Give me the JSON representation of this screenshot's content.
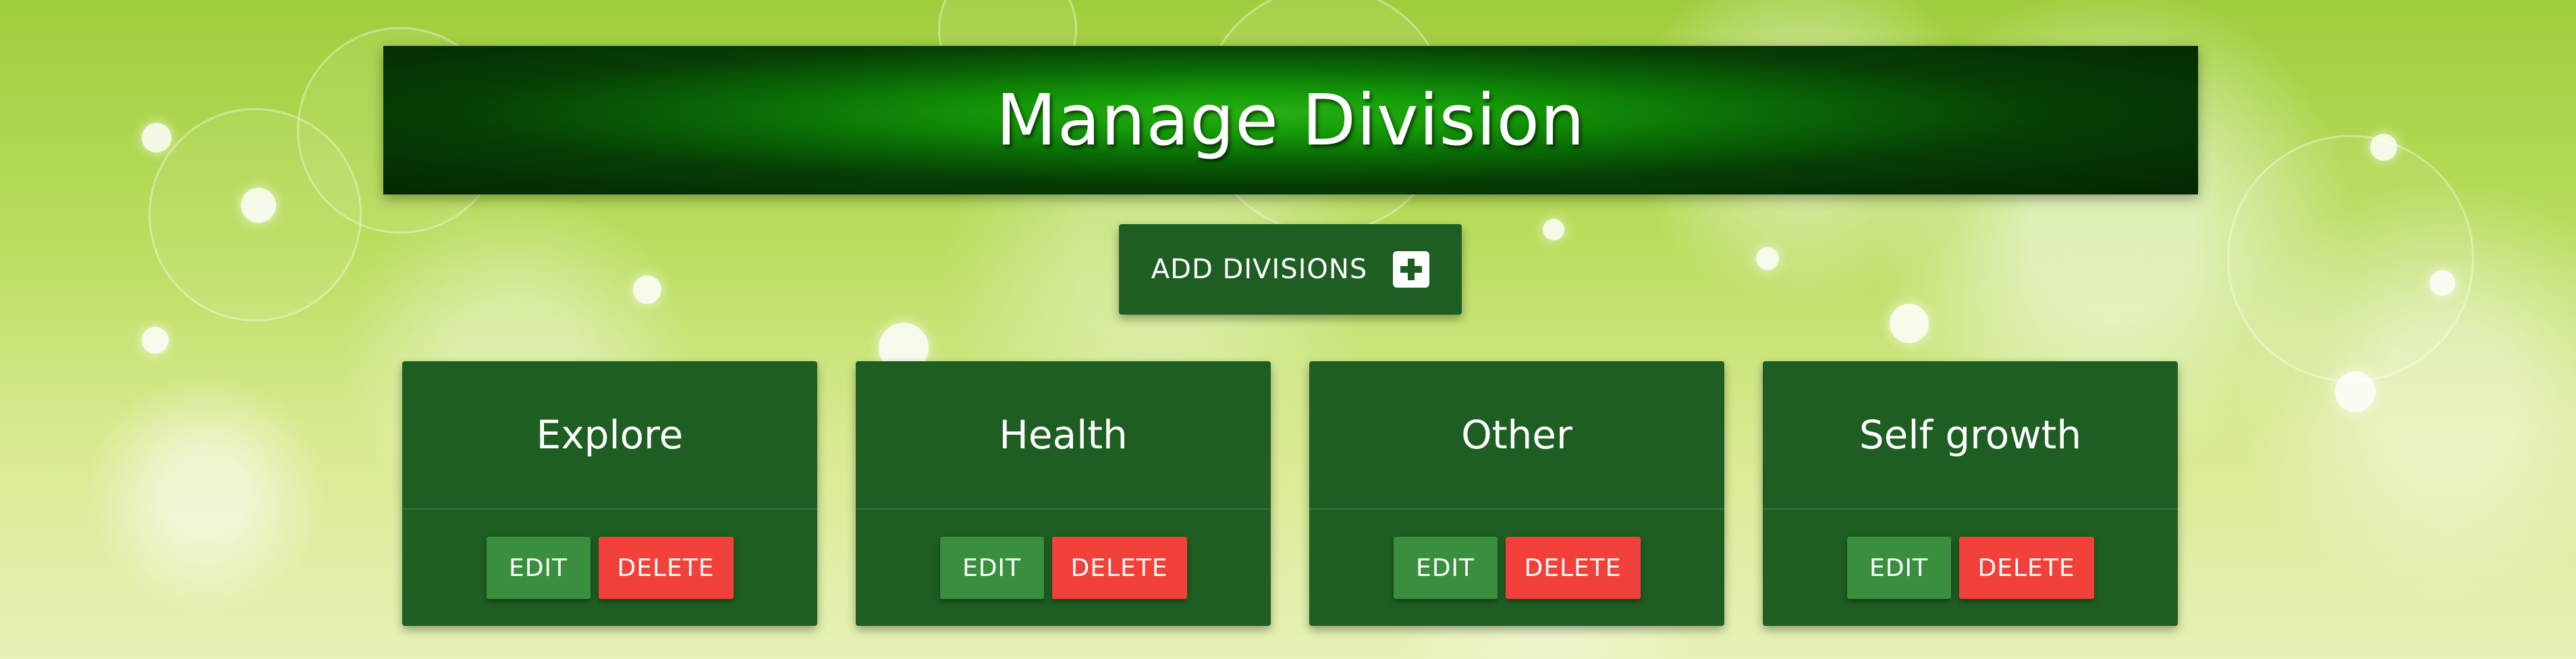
{
  "page": {
    "title": "Manage Division",
    "background_color": "#b8dd5c",
    "header_color": "#0a6b06"
  },
  "add_button": {
    "label": "ADD DIVISIONS",
    "icon": "plus-square-icon",
    "color": "#1e5e22"
  },
  "divisions": [
    {
      "name": "Explore",
      "edit_label": "EDIT",
      "delete_label": "DELETE"
    },
    {
      "name": "Health",
      "edit_label": "EDIT",
      "delete_label": "DELETE"
    },
    {
      "name": "Other",
      "edit_label": "EDIT",
      "delete_label": "DELETE"
    },
    {
      "name": "Self growth",
      "edit_label": "EDIT",
      "delete_label": "DELETE"
    }
  ],
  "colors": {
    "card": "#1e5e22",
    "edit": "#3a8f3e",
    "delete": "#f2403a",
    "text": "#ffffff"
  }
}
